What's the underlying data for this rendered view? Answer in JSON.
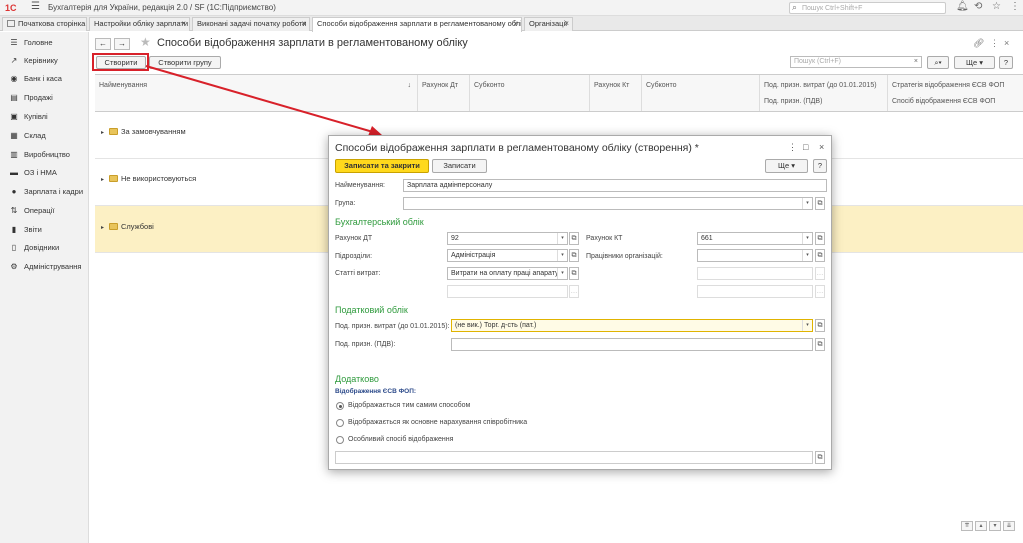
{
  "topbar": {
    "logo": "1С",
    "logo_sub": "ПРЕДПРИЯТИЕ",
    "app_title": "Бухгалтерія для України, редакція 2.0 / SF  (1С:Підприємство)",
    "search_placeholder": "Пошук Ctrl+Shift+F"
  },
  "tabs": [
    {
      "label": "Початкова сторінка"
    },
    {
      "label": "Настройки обліку зарплати"
    },
    {
      "label": "Виконані задачі початку роботи"
    },
    {
      "label": "Способи відображення зарплати в регламентованому обліку"
    },
    {
      "label": "Організації"
    }
  ],
  "sidebar": {
    "items": [
      {
        "label": "Головне",
        "icon": "menu-icon"
      },
      {
        "label": "Керівнику",
        "icon": "chart-icon"
      },
      {
        "label": "Банк і каса",
        "icon": "bank-icon"
      },
      {
        "label": "Продажі",
        "icon": "sales-icon"
      },
      {
        "label": "Купівлі",
        "icon": "purchases-icon"
      },
      {
        "label": "Склад",
        "icon": "warehouse-icon"
      },
      {
        "label": "Виробництво",
        "icon": "production-icon"
      },
      {
        "label": "ОЗ і НМА",
        "icon": "assets-icon"
      },
      {
        "label": "Зарплата і кадри",
        "icon": "user-icon"
      },
      {
        "label": "Операції",
        "icon": "operations-icon"
      },
      {
        "label": "Звіти",
        "icon": "reports-icon"
      },
      {
        "label": "Довідники",
        "icon": "book-icon"
      },
      {
        "label": "Адміністрування",
        "icon": "gear-icon"
      }
    ]
  },
  "main": {
    "title": "Способи відображення зарплати в регламентованому обліку",
    "create_label": "Створити",
    "create_group_label": "Створити групу",
    "search_placeholder": "Пошук (Ctrl+F)",
    "more_label": "Ще",
    "help_label": "?",
    "columns": {
      "name": "Найменування",
      "sort": "↓",
      "dt": "Рахунок Дт",
      "subconto1": "Субконто",
      "kt": "Рахунок Кт",
      "subconto2": "Субконто",
      "tax1": "Под. призн. витрат (до 01.01.2015)",
      "tax2": "Под. призн. (ПДВ)",
      "esv1": "Стратегія відображення ЄСВ ФОП",
      "esv2": "Спосіб відображення ЄСВ ФОП"
    },
    "rows": [
      {
        "label": "За замовчуванням"
      },
      {
        "label": "Не використовуються"
      },
      {
        "label": "Службові"
      }
    ]
  },
  "dialog": {
    "title": "Способи відображення зарплати в регламентованому обліку (створення) *",
    "save_close_label": "Записати та закрити",
    "save_label": "Записати",
    "more_label": "Ще",
    "help_label": "?",
    "name_label": "Найменування:",
    "name_value": "Зарплата адмінперсоналу",
    "group_label": "Група:",
    "group_value": "",
    "accounting_section": "Бухгалтерський облік",
    "dt_label": "Рахунок ДТ",
    "dt_value": "92",
    "kt_label": "Рахунок КТ",
    "kt_value": "661",
    "dept_label": "Підрозділи:",
    "dept_value": "Адміністрація",
    "employees_label": "Працівники організацій:",
    "employees_value": "",
    "costs_label": "Статті витрат:",
    "costs_value": "Витрати на оплату праці апарату у",
    "tax_section": "Податковий облік",
    "tax1_label": "Под. призн. витрат (до 01.01.2015):",
    "tax1_value": "(не вик.) Торг. д-сть (пат.)",
    "tax2_label": "Под. призн. (ПДВ):",
    "tax2_value": "",
    "extra_section": "Додатково",
    "esv_label": "Відображення ЄСВ ФОП:",
    "radio1": "Відображається тим самим способом",
    "radio2": "Відображається як основне нарахування співробітника",
    "radio3": "Особливий спосіб відображення",
    "selected_radio": 1
  }
}
